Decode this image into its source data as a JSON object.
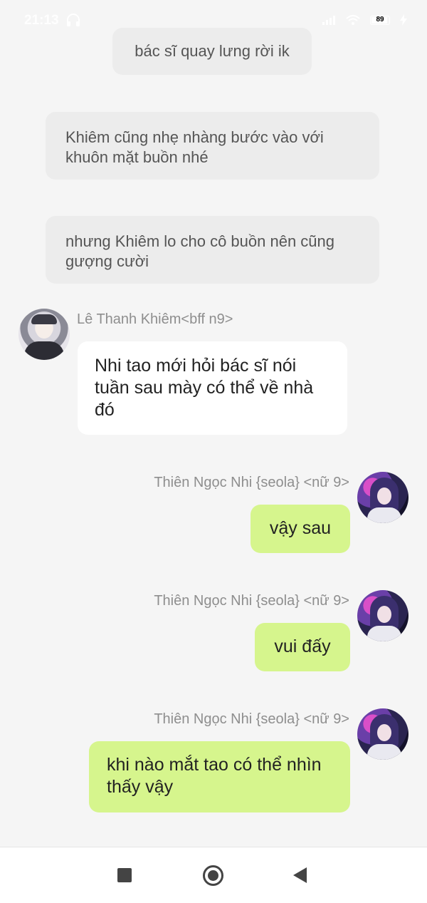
{
  "status_bar": {
    "time": "21:13",
    "battery": "89"
  },
  "narrations": [
    {
      "text": "bác sĩ quay lưng rời ik"
    },
    {
      "text": "Khiêm cũng nhẹ nhàng bước vào với khuôn mặt buồn nhé"
    },
    {
      "text": "nhưng Khiêm lo cho cô buồn nên cũng gượng cười"
    }
  ],
  "messages": [
    {
      "sender": "Lê Thanh Khiêm<bff n9>",
      "side": "left",
      "text": "Nhi tao mới hỏi bác sĩ nói tuần sau mày có thể về nhà đó",
      "bubble_color": "#ffffff"
    },
    {
      "sender": "Thiên Ngọc Nhi {seola} <nữ 9>",
      "side": "right",
      "text": "vậy sau",
      "bubble_color": "#d6f58d"
    },
    {
      "sender": "Thiên Ngọc Nhi {seola} <nữ 9>",
      "side": "right",
      "text": "vui đấy",
      "bubble_color": "#d6f58d"
    },
    {
      "sender": "Thiên Ngọc Nhi {seola} <nữ 9>",
      "side": "right",
      "text": "khi nào mắt tao có thể nhìn thấy vậy",
      "bubble_color": "#d6f58d"
    }
  ],
  "nav_bar": {
    "icons": [
      "recent-apps-icon",
      "home-icon",
      "back-icon"
    ]
  }
}
